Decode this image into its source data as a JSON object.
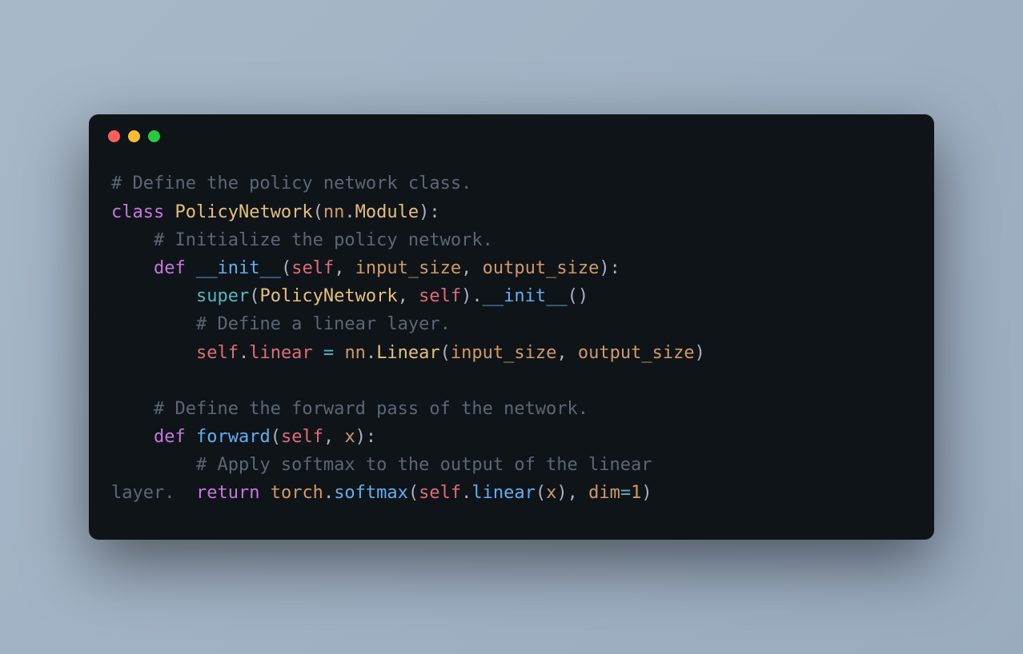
{
  "colors": {
    "background_gradient_start": "#a8b8c8",
    "background_gradient_end": "#9aabc0",
    "editor_bg": "#0f1419",
    "traffic_red": "#ff5f56",
    "traffic_yellow": "#ffbd2e",
    "traffic_green": "#27c93f",
    "comment": "#5c6773",
    "keyword": "#c678dd",
    "class_name": "#e5c07b",
    "function_name": "#61afef",
    "param": "#d19a66",
    "self": "#e06c75",
    "punct": "#abb2bf",
    "operator": "#56b6c2",
    "property": "#e06c75",
    "number": "#d19a66",
    "builtin": "#56b6c2"
  },
  "code": {
    "line1_comment": "# Define the policy network class.",
    "line2_class": "class",
    "line2_classname": "PolicyNetwork",
    "line2_paren_open": "(",
    "line2_nn": "nn",
    "line2_dot": ".",
    "line2_module": "Module",
    "line2_paren_close": "):",
    "line3_comment": "# Initialize the policy network.",
    "line4_def": "def",
    "line4_init": "__init__",
    "line4_paren_open": "(",
    "line4_self": "self",
    "line4_comma1": ", ",
    "line4_p1": "input_size",
    "line4_comma2": ", ",
    "line4_p2": "output_size",
    "line4_paren_close": "):",
    "line5_super": "super",
    "line5_paren_open": "(",
    "line5_policynet": "PolicyNetwork",
    "line5_comma": ", ",
    "line5_self": "self",
    "line5_paren_close": ").",
    "line5_init": "__init__",
    "line5_call": "()",
    "line6_comment": "# Define a linear layer.",
    "line7_self": "self",
    "line7_dot": ".",
    "line7_linear": "linear",
    "line7_eq": " = ",
    "line7_nn": "nn",
    "line7_dot2": ".",
    "line7_Linear": "Linear",
    "line7_paren_open": "(",
    "line7_p1": "input_size",
    "line7_comma": ", ",
    "line7_p2": "output_size",
    "line7_paren_close": ")",
    "line9_comment": "# Define the forward pass of the network.",
    "line10_def": "def",
    "line10_forward": "forward",
    "line10_paren_open": "(",
    "line10_self": "self",
    "line10_comma": ", ",
    "line10_x": "x",
    "line10_paren_close": "):",
    "line11_comment": "# Apply softmax to the output of the linear ",
    "line12_layer": "layer.  ",
    "line12_return": "return",
    "line12_torch": "torch",
    "line12_dot": ".",
    "line12_softmax": "softmax",
    "line12_paren_open": "(",
    "line12_self": "self",
    "line12_dot2": ".",
    "line12_linear": "linear",
    "line12_paren2_open": "(",
    "line12_x": "x",
    "line12_paren2_close": "), ",
    "line12_dim": "dim",
    "line12_eq": "=",
    "line12_one": "1",
    "line12_paren_close": ")"
  },
  "indent1": "    ",
  "indent2": "        "
}
